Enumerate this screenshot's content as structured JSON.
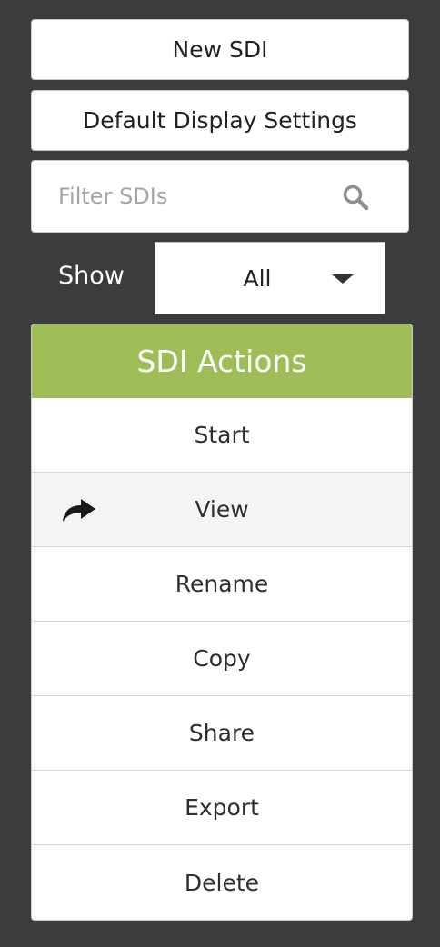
{
  "buttons": {
    "new_sdi": "New SDI",
    "default_display_settings": "Default Display Settings"
  },
  "filter": {
    "placeholder": "Filter SDIs",
    "icon": "search-icon"
  },
  "show": {
    "label": "Show",
    "selected": "All"
  },
  "actions_panel": {
    "title": "SDI Actions",
    "header_color": "#9ebd57",
    "items": [
      {
        "label": "Start"
      },
      {
        "label": "View"
      },
      {
        "label": "Rename"
      },
      {
        "label": "Copy"
      },
      {
        "label": "Share"
      },
      {
        "label": "Export"
      },
      {
        "label": "Delete"
      }
    ],
    "hovered_item": "View",
    "cursor_icon": "share-arrow-icon"
  }
}
